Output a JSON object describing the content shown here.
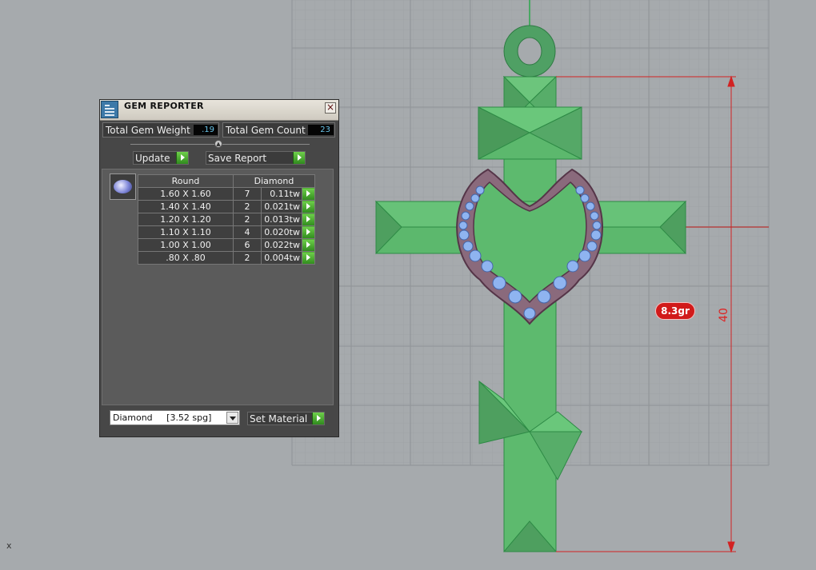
{
  "viewport": {
    "axis_label": "x",
    "weight_badge": "8.3gr",
    "dimension_label": "40"
  },
  "panel": {
    "title": "GEM REPORTER",
    "close_icon": "close-icon",
    "total_weight_label": "Total Gem Weight",
    "total_weight_value": ".19",
    "total_count_label": "Total Gem Count",
    "total_count_value": "23",
    "update_label": "Update",
    "save_report_label": "Save Report",
    "table": {
      "headers": [
        "Round",
        "Diamond"
      ],
      "rows": [
        {
          "size": "1.60 X 1.60",
          "count": "7",
          "weight": "0.11tw"
        },
        {
          "size": "1.40 X 1.40",
          "count": "2",
          "weight": "0.021tw"
        },
        {
          "size": "1.20 X 1.20",
          "count": "2",
          "weight": "0.013tw"
        },
        {
          "size": "1.10 X 1.10",
          "count": "4",
          "weight": "0.020tw"
        },
        {
          "size": "1.00 X 1.00",
          "count": "6",
          "weight": "0.022tw"
        },
        {
          "size": ".80 X .80",
          "count": "2",
          "weight": "0.004tw"
        }
      ]
    },
    "material_value": "Diamond     [3.52 spg]",
    "set_material_label": "Set Material"
  },
  "colors": {
    "background": "#a6aaad",
    "metal_green": "#5fb370",
    "dimension_red": "#d22222",
    "gem_blue": "#8fb4f0",
    "panel_dark": "#474747",
    "accent_green": "#46b02c"
  }
}
